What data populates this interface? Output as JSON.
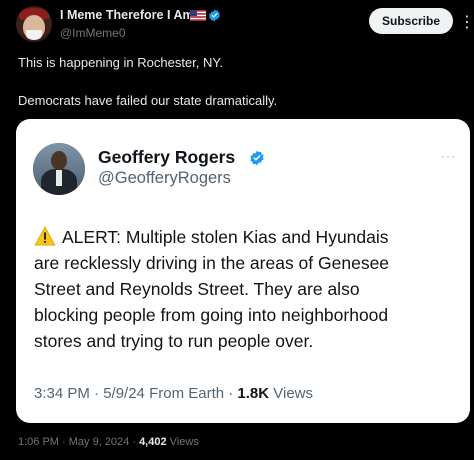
{
  "author": {
    "name": "I Meme Therefore I Am",
    "handle": "@ImMeme0",
    "flag": "flag-us-icon",
    "verified_color": "#1d9bf0"
  },
  "subscribe_label": "Subscribe",
  "tweet_lines": [
    "This is happening in Rochester, NY.",
    "Democrats have failed our state dramatically."
  ],
  "quote": {
    "name": "Geoffery Rogers",
    "handle": "@GeofferyRogers",
    "body_lines": [
      "ALERT: Multiple stolen Kias and Hyundais",
      "are recklessly driving in the areas of Genesee",
      "Street and Reynolds Street. They are also",
      "blocking people from going into neighborhood",
      "stores and trying to run people over."
    ],
    "meta_prefix": "3:34 PM · 5/9/24 From Earth · ",
    "views_count": "1.8K",
    "views_label": " Views"
  },
  "footer": {
    "time": "1:06 PM · May 9, 2024 · ",
    "views_count": "4,402",
    "views_label": " Views"
  },
  "colors": {
    "background": "#000000",
    "card": "#ffffff",
    "accent": "#1d9bf0",
    "warning": "#f5c518"
  }
}
